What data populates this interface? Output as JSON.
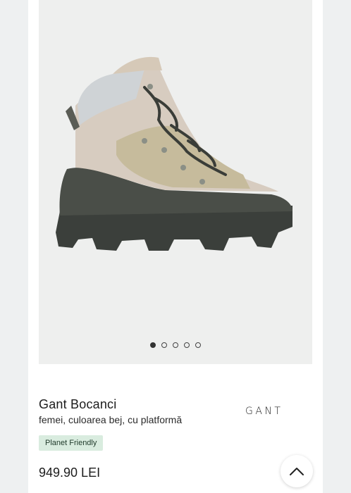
{
  "product": {
    "brand_title": "Gant Bocanci",
    "subtitle": "femei, culoarea bej, cu platformă",
    "brand_logo": "GANT",
    "badge": "Planet Friendly",
    "price": "949.90 LEI"
  },
  "gallery": {
    "total_images": 5,
    "active_index": 0,
    "image": "boot-photo"
  },
  "icons": {
    "scroll_top": "chevron-up-icon"
  },
  "colors": {
    "badge_bg": "#d9ecdf",
    "gallery_bg": "#eeefee",
    "page_bg": "#eef0f1"
  }
}
